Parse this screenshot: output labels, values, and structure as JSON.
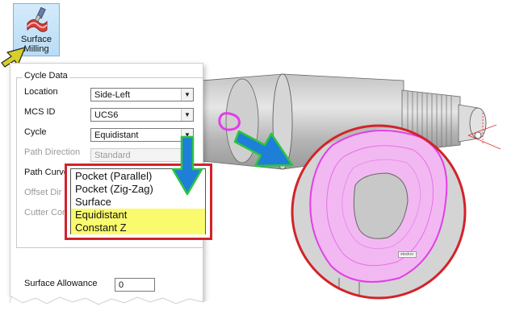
{
  "ribbon": {
    "surface_milling_line1": "Surface",
    "surface_milling_line2": "Milling"
  },
  "dialog": {
    "group_title": "Cycle Data",
    "fields": {
      "location": {
        "label": "Location",
        "value": "Side-Left"
      },
      "mcs_id": {
        "label": "MCS ID",
        "value": "UCS6"
      },
      "cycle": {
        "label": "Cycle",
        "value": "Equidistant"
      },
      "path_direction": {
        "label": "Path Direction",
        "value": "Standard"
      },
      "path_curve": {
        "label": "Path Curve"
      },
      "offset_dir": {
        "label": "Offset Dir"
      },
      "cutter_con": {
        "label": "Cutter Con"
      }
    },
    "surface_allowance": {
      "label": "Surface Allowance",
      "value": "0"
    }
  },
  "cycle_dropdown": {
    "options": [
      "Pocket (Parallel)",
      "Pocket (Zig-Zag)",
      "Surface",
      "Equidistant",
      "Constant Z"
    ],
    "highlighted": [
      "Equidistant",
      "Constant Z"
    ]
  },
  "viewport": {
    "stock_tag": "stockcv"
  },
  "colors": {
    "ribbon_bg": "#c7e3f8",
    "dropdown_border": "#d2232a",
    "highlight": "#fafa6e",
    "toolpath": "#e23ee6",
    "arrow_fill": "#1e7fd8",
    "arrow_outline": "#2cc43f",
    "pointer_arrow": "#d7cf2a"
  }
}
